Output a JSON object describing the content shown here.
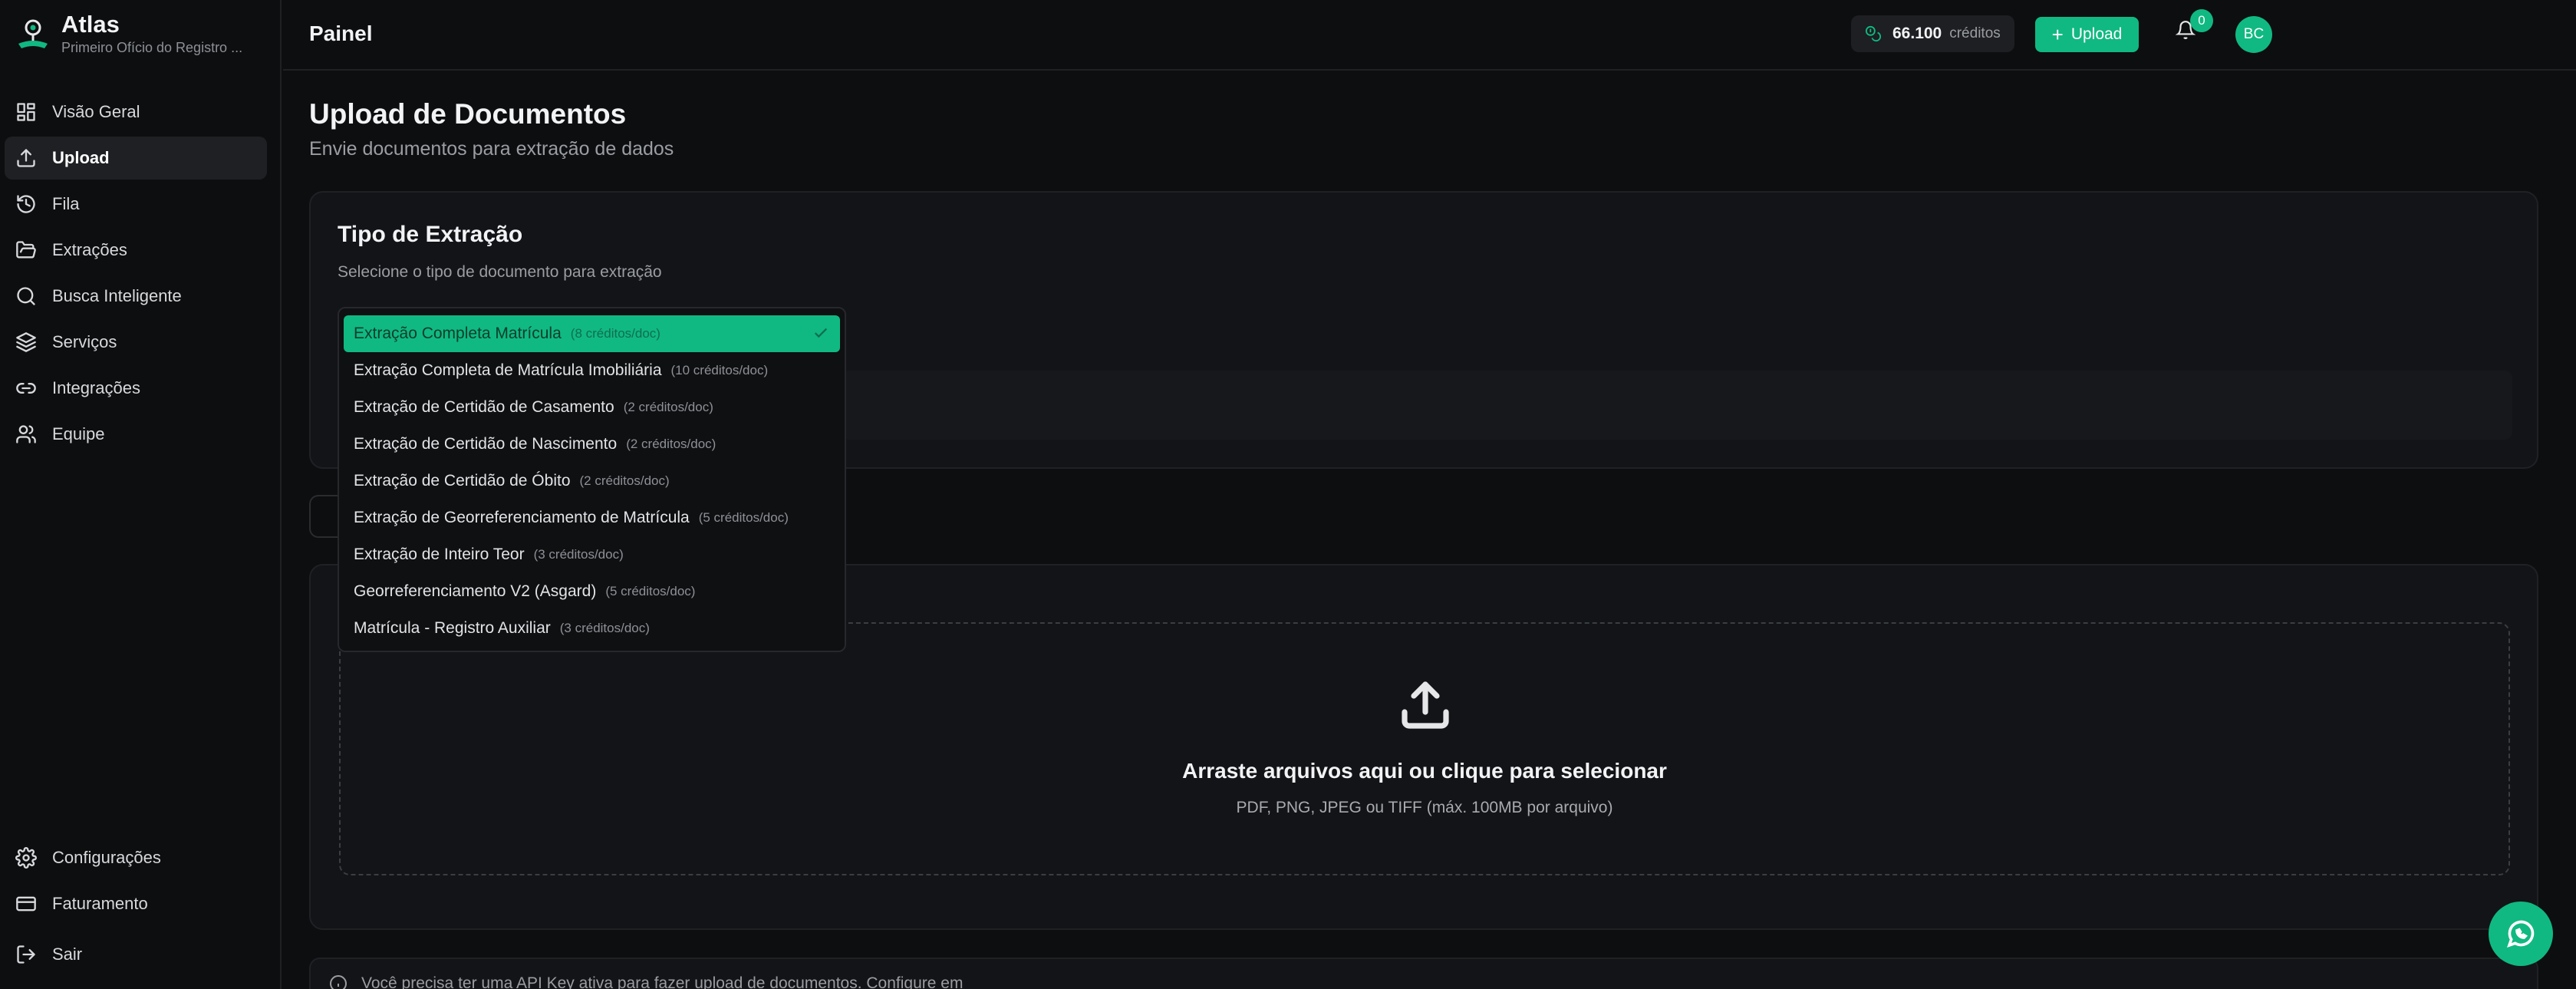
{
  "brand": {
    "name": "Atlas",
    "subtitle": "Primeiro Ofício do Registro ..."
  },
  "sidebar": {
    "items": [
      {
        "label": "Visão Geral",
        "icon": "grid-icon"
      },
      {
        "label": "Upload",
        "icon": "upload-icon",
        "active": true
      },
      {
        "label": "Fila",
        "icon": "history-icon"
      },
      {
        "label": "Extrações",
        "icon": "folder-open-icon"
      },
      {
        "label": "Busca Inteligente",
        "icon": "search-icon"
      },
      {
        "label": "Serviços",
        "icon": "layers-icon"
      },
      {
        "label": "Integrações",
        "icon": "link-icon"
      },
      {
        "label": "Equipe",
        "icon": "users-icon"
      }
    ],
    "bottom": [
      {
        "label": "Configurações",
        "icon": "gear-icon"
      },
      {
        "label": "Faturamento",
        "icon": "credit-card-icon"
      },
      {
        "label": "Sair",
        "icon": "logout-icon"
      }
    ]
  },
  "header": {
    "title": "Painel",
    "credits_value": "66.100",
    "credits_unit": "créditos",
    "upload_label": "Upload",
    "notifications_count": "0",
    "avatar_initials": "BC"
  },
  "main": {
    "title": "Upload de Documentos",
    "subtitle": "Envie documentos para extração de dados",
    "extraction": {
      "heading": "Tipo de Extração",
      "description": "Selecione o tipo de documento para extração",
      "options": [
        {
          "label": "Extração Completa Matrícula",
          "cost": "(8 créditos/doc)",
          "selected": true
        },
        {
          "label": "Extração Completa de Matrícula Imobiliária",
          "cost": "(10 créditos/doc)"
        },
        {
          "label": "Extração de Certidão de Casamento",
          "cost": "(2 créditos/doc)"
        },
        {
          "label": "Extração de Certidão de Nascimento",
          "cost": "(2 créditos/doc)"
        },
        {
          "label": "Extração de Certidão de Óbito",
          "cost": "(2 créditos/doc)"
        },
        {
          "label": "Extração de Georreferenciamento de Matrícula",
          "cost": "(5 créditos/doc)"
        },
        {
          "label": "Extração de Inteiro Teor",
          "cost": "(3 créditos/doc)"
        },
        {
          "label": "Georreferenciamento V2 (Asgard)",
          "cost": "(5 créditos/doc)"
        },
        {
          "label": "Matrícula - Registro Auxiliar",
          "cost": "(3 créditos/doc)"
        }
      ]
    },
    "dropzone": {
      "title": "Arraste arquivos aqui ou clique para selecionar",
      "subtitle": "PDF, PNG, JPEG ou TIFF (máx. 100MB por arquivo)"
    },
    "notice": "Você precisa ter uma API Key ativa para fazer upload de documentos. Configure em"
  },
  "colors": {
    "accent": "#10b981",
    "background": "#0d0e10",
    "card": "#131417"
  }
}
